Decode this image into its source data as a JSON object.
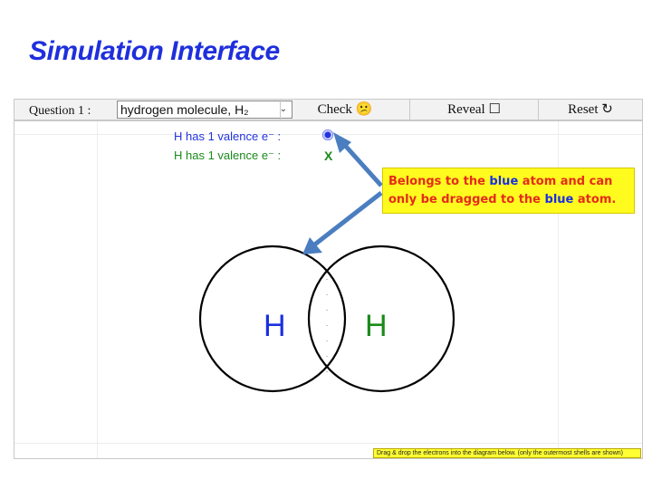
{
  "page": {
    "title": "Simulation Interface"
  },
  "toolbar": {
    "question_label": "Question 1 :",
    "question_select_value": "hydrogen molecule, H₂",
    "check_label": "Check",
    "reveal_label": "Reveal",
    "reset_label": "Reset",
    "check_icon": "😕",
    "reveal_icon": "☐",
    "reset_icon": "↻"
  },
  "valence": [
    {
      "text": "H has 1 valence e⁻ :",
      "color": "#2233dd",
      "status": "electron-present"
    },
    {
      "text": "H has 1 valence e⁻ :",
      "color": "#1a8a1a",
      "status": "X"
    }
  ],
  "callout": {
    "part1": "Belongs to the ",
    "blue1": "blue",
    "part2": " atom and can only be dragged to the ",
    "blue2": "blue",
    "part3": " atom."
  },
  "atoms": [
    {
      "symbol": "H",
      "color": "#1a2fe0"
    },
    {
      "symbol": "H",
      "color": "#1a8a1a"
    }
  ],
  "hint": "Drag & drop the electrons into the diagram below. (only the outermost shells are shown)",
  "colors": {
    "title": "#1f2fdc",
    "arrow": "#4a7ec0",
    "callout_bg": "#fffb1e"
  }
}
